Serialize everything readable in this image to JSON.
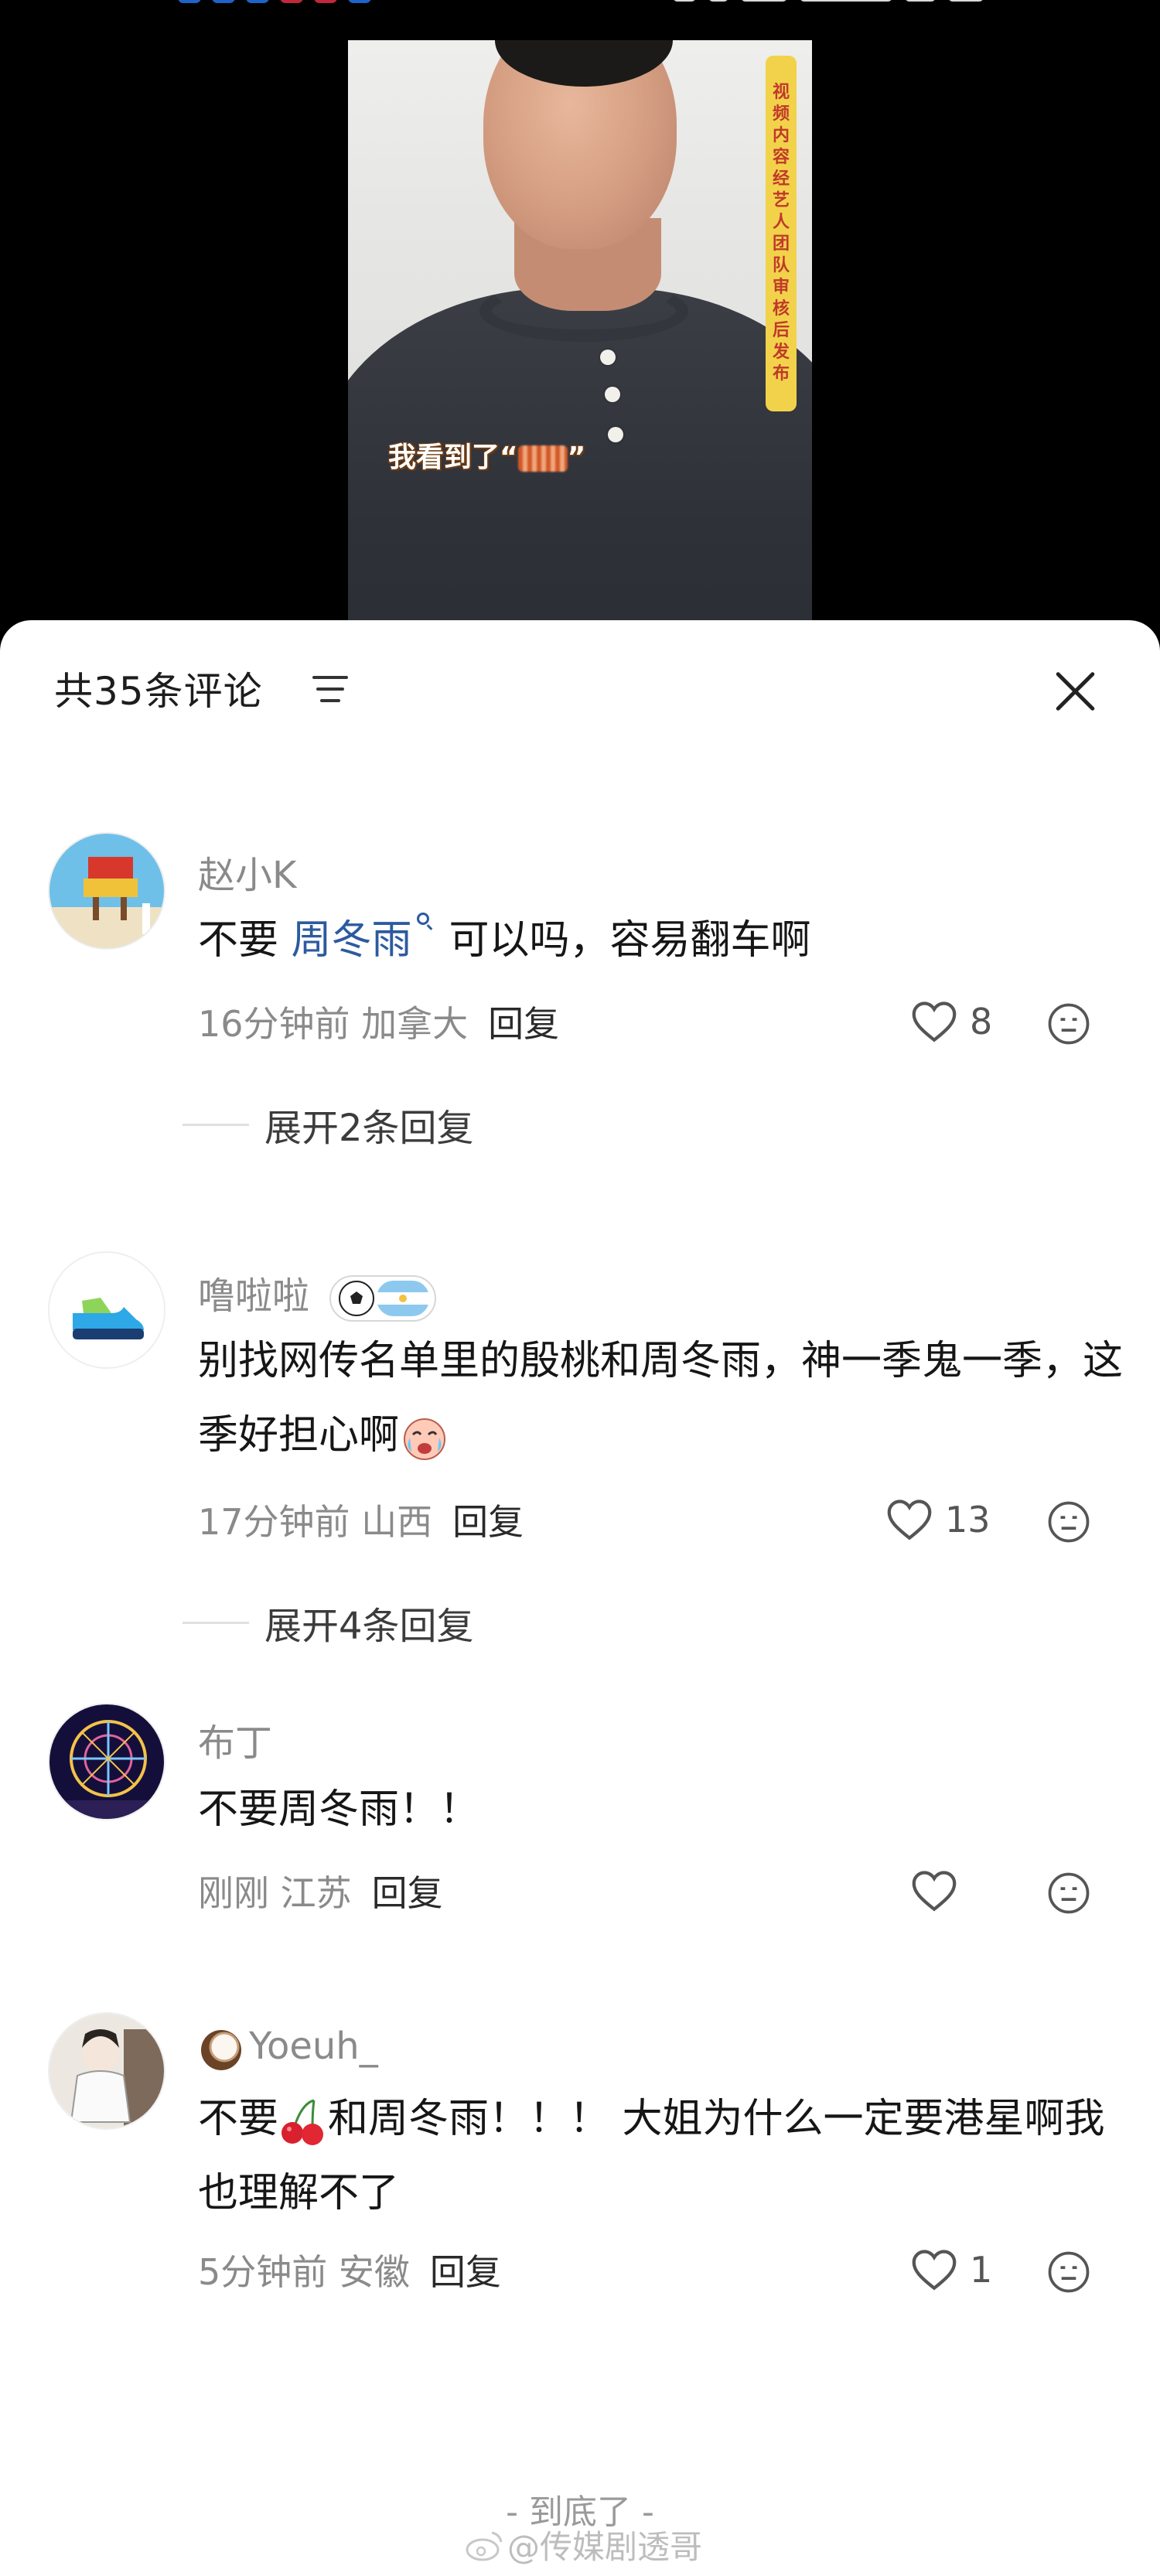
{
  "video": {
    "caption_text": "我看到了“",
    "caption_end": "”",
    "side_badge_chars": [
      "视",
      "频",
      "内",
      "容",
      "经",
      "艺",
      "人",
      "团",
      "队",
      "审",
      "核",
      "后",
      "发",
      "布"
    ]
  },
  "sheet": {
    "title": "共35条评论"
  },
  "comments": [
    {
      "username": "赵小K",
      "text_before": "不要 ",
      "mention": "周冬雨",
      "text_after": "可以吗，容易翻车啊",
      "time": "16分钟前",
      "location": "加拿大",
      "reply_label": "回复",
      "likes": "8",
      "expand_label": "展开2条回复"
    },
    {
      "username": "噜啦啦",
      "text": "别找网传名单里的殷桃和周冬雨，神一季鬼一季，这季好担心啊",
      "time": "17分钟前",
      "location": "山西",
      "reply_label": "回复",
      "likes": "13",
      "expand_label": "展开4条回复"
    },
    {
      "username": "布丁",
      "text": "不要周冬雨！！",
      "time": "刚刚",
      "location": "江苏",
      "reply_label": "回复",
      "likes": ""
    },
    {
      "username": "Yoeuh_",
      "text_before": "不要",
      "text_after": "和周冬雨！！！ 大姐为什么一定要港星啊我也理解不了",
      "time": "5分钟前",
      "location": "安徽",
      "reply_label": "回复",
      "likes": "1"
    }
  ],
  "footer": {
    "end_label": "- 到底了 -",
    "watermark": "@传媒剧透哥"
  },
  "icons": {
    "like": "heart-outline-icon",
    "dislike": "neutral-face-icon",
    "close": "close-icon",
    "filter": "sort-filter-icon"
  },
  "colors": {
    "mention": "#2c5aa0",
    "meta_gray": "#8a8a8a",
    "sheet_bg": "#ffffff",
    "video_bg": "#000000"
  }
}
